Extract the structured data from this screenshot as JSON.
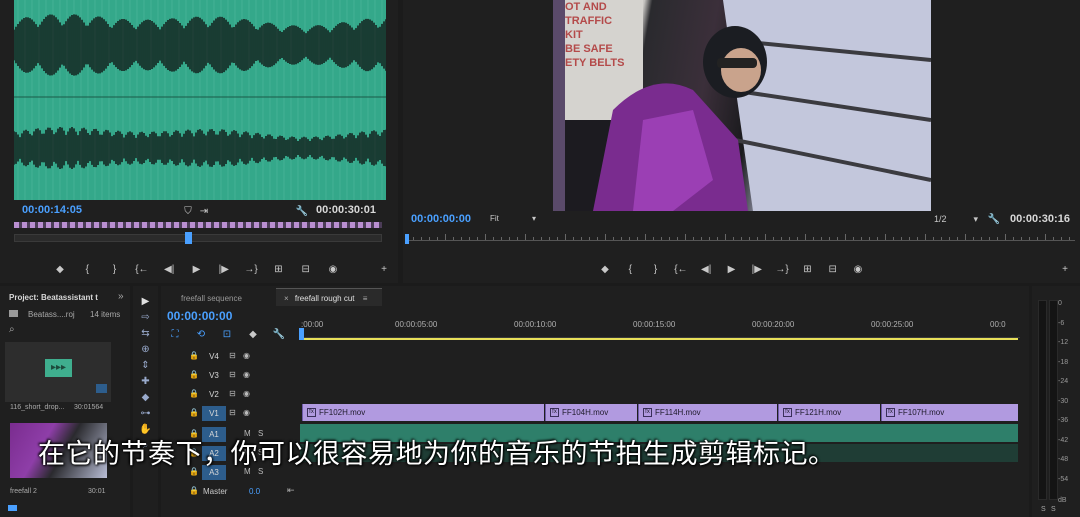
{
  "source_monitor": {
    "current_time": "00:00:14:05",
    "duration": "00:00:30:01",
    "controls": [
      "◆",
      "{",
      "}",
      "{←",
      "◀|",
      "▶",
      "|▶",
      "→}",
      "⊞",
      "⊟",
      "◉",
      "+"
    ]
  },
  "program_monitor": {
    "current_time": "00:00:00:00",
    "zoom": "Fit",
    "resolution": "1/2",
    "duration": "00:00:30:16",
    "controls": [
      "◆",
      "{",
      "}",
      "{←",
      "◀|",
      "▶",
      "|▶",
      "→}",
      "⊞",
      "⊟",
      "◉",
      "+"
    ],
    "video_signs": [
      "OT AND",
      "TRAFFIC",
      "KIT",
      "BE SAFE",
      "ETY BELTS"
    ]
  },
  "project": {
    "title": "Project: Beatassistant t",
    "menu": "»",
    "path": "Beatass....roj",
    "item_count": "14 items",
    "items": [
      {
        "name": "116_short_drop...",
        "duration": "30:01564"
      },
      {
        "name": "freefall 2",
        "duration": "30:01"
      }
    ]
  },
  "timeline": {
    "tabs": [
      {
        "label": "freefall sequence",
        "active": false
      },
      {
        "label": "freefall rough cut",
        "active": true
      }
    ],
    "tab_menu": "≡",
    "timecode": "00:00:00:00",
    "ruler": [
      ":00:00",
      "00:00:05:00",
      "00:00:10:00",
      "00:00:15:00",
      "00:00:20:00",
      "00:00:25:00",
      "00:0"
    ],
    "tracks": [
      {
        "name": "V4"
      },
      {
        "name": "V3"
      },
      {
        "name": "V2"
      },
      {
        "name": "V1"
      },
      {
        "name": "A1"
      },
      {
        "name": "A2"
      },
      {
        "name": "A3"
      }
    ],
    "track_mute": "M",
    "track_solo": "S",
    "master": {
      "label": "Master",
      "value": "0.0"
    },
    "clips": [
      "FF102H.mov",
      "FF104H.mov",
      "FF114H.mov",
      "FF121H.mov",
      "FF107H.mov"
    ]
  },
  "audio_meter": {
    "labels": [
      "0",
      "-6",
      "-12",
      "-18",
      "-24",
      "-30",
      "-36",
      "-42",
      "-48",
      "-54"
    ],
    "unit": "dB",
    "solo_labels": [
      "S",
      "S"
    ]
  },
  "subtitle": "在它的节奏下，你可以很容易地为你的音乐的节拍生成剪辑标记。",
  "colors": {
    "accent_blue": "#4aa0ff",
    "waveform_bg": "#34a88a",
    "clip_purple": "#b19ae0",
    "playhead": "#e8e05a"
  }
}
